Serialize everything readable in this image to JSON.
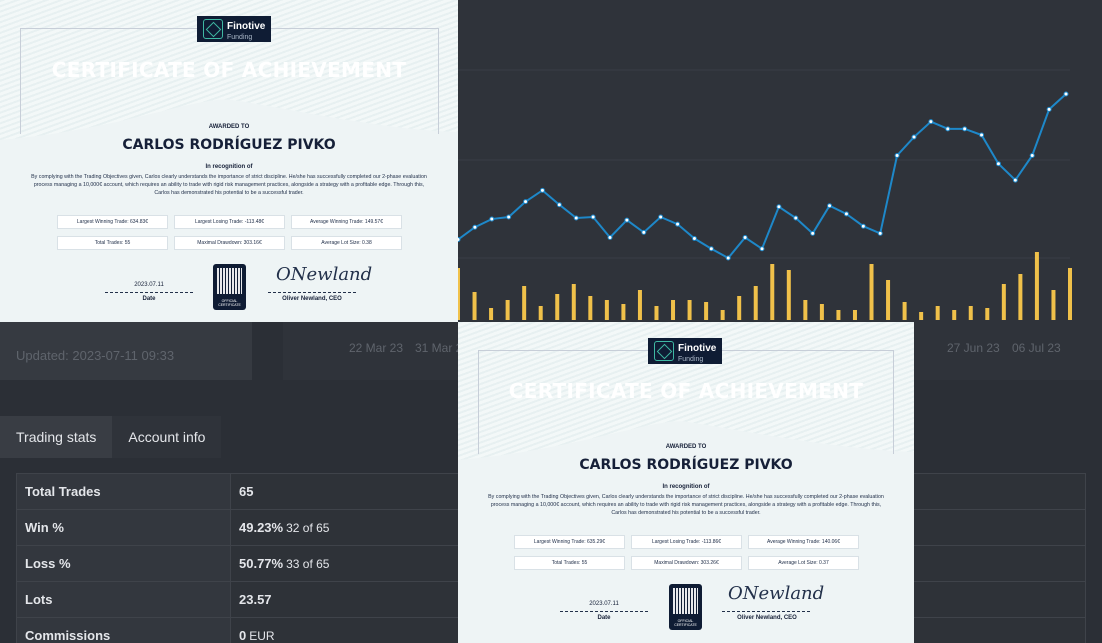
{
  "dashboard": {
    "updated": "Updated: 2023-07-11 09:33",
    "x_ticks": [
      "22 Mar 23",
      "31 Mar 2",
      "27 Jun 23",
      "06 Jul 23"
    ],
    "tabs": [
      {
        "label": "Trading stats",
        "active": true
      },
      {
        "label": "Account info",
        "active": false
      }
    ],
    "stats": [
      {
        "label": "Total Trades",
        "value": "65",
        "sub": ""
      },
      {
        "label": "Win %",
        "value": "49.23%",
        "sub": "32 of 65"
      },
      {
        "label": "Loss %",
        "value": "50.77%",
        "sub": "33 of 65"
      },
      {
        "label": "Lots",
        "value": "23.57",
        "sub": ""
      },
      {
        "label": "Commissions",
        "value": "0",
        "sub": "EUR"
      }
    ]
  },
  "colors": {
    "line": "#1e88c9",
    "bars": "#f0c14a",
    "navy": "#0f1c34"
  },
  "chart_data": {
    "type": "line",
    "line_series": [
      18,
      30,
      38,
      40,
      55,
      66,
      52,
      39,
      40,
      20,
      37,
      25,
      40,
      33,
      19,
      9,
      0,
      20,
      9,
      50,
      39,
      24,
      51,
      43,
      31,
      24,
      100,
      118,
      133,
      126,
      126,
      120,
      92,
      76,
      100,
      145,
      160
    ],
    "bar_values": [
      52,
      28,
      12,
      20,
      34,
      14,
      26,
      36,
      24,
      20,
      16,
      30,
      14,
      20,
      20,
      18,
      10,
      24,
      34,
      56,
      50,
      20,
      16,
      10,
      10,
      56,
      40,
      18,
      8,
      14,
      10,
      14,
      12,
      36,
      46,
      68,
      30,
      52
    ],
    "grid": true
  },
  "certificates": [
    {
      "logo_name": "Finotive",
      "logo_sub": "Funding",
      "title": "CERTIFICATE OF ACHIEVEMENT",
      "awarded_to": "AWARDED TO",
      "recipient": "CARLOS RODRÍGUEZ PIVKO",
      "recognition": "In recognition of",
      "body": "By complying with the Trading Objectives given, Carlos clearly understands the importance of strict discipline. He/she has successfully completed our 2-phase evaluation process managing a 10,000€ account, which requires an ability to trade with rigid risk management practices, alongside a strategy with a profitable edge. Through this, Carlos has demonstrated his potential to be a successful trader.",
      "stats": [
        "Largest Winning Trade: 634.83€",
        "Largest Losing Trade: -113.48€",
        "Average Winning Trade: 149.57€",
        "Total Trades: 55",
        "Maximal Drawdown: 303.16€",
        "Average Lot Size: 0.38"
      ],
      "date": "2023.07.11",
      "date_label": "Date",
      "qr_label": "OFFICIAL CERTIFICATE",
      "signature": "ONewland",
      "signer": "Oliver Newland, CEO"
    },
    {
      "logo_name": "Finotive",
      "logo_sub": "Funding",
      "title": "CERTIFICATE OF ACHIEVEMENT",
      "awarded_to": "AWARDED TO",
      "recipient": "CARLOS RODRÍGUEZ PIVKO",
      "recognition": "In recognition of",
      "body": "By complying with the Trading Objectives given, Carlos clearly understands the importance of strict discipline. He/she has successfully completed our 2-phase evaluation process managing a 10,000€ account, which requires an ability to trade with rigid risk management practices, alongside a strategy with a profitable edge. Through this, Carlos has demonstrated his potential to be a successful trader.",
      "stats": [
        "Largest Winning Trade: 635.29€",
        "Largest Losing Trade: -113.86€",
        "Average Winning Trade: 140.06€",
        "Total Trades: 55",
        "Maximal Drawdown: 303.26€",
        "Average Lot Size: 0.37"
      ],
      "date": "2023.07.11",
      "date_label": "Date",
      "qr_label": "OFFICIAL CERTIFICATE",
      "signature": "ONewland",
      "signer": "Oliver Newland, CEO"
    }
  ]
}
